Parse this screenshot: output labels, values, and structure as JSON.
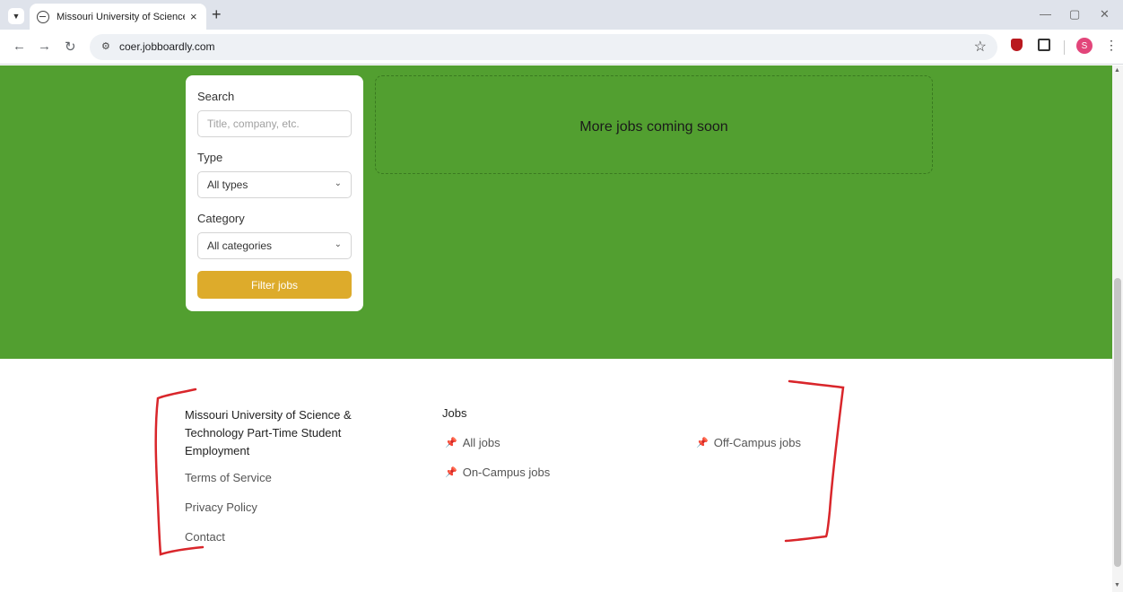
{
  "browser": {
    "tab_title": "Missouri University of Science &",
    "url": "coer.jobboardly.com",
    "profile_initial": "S",
    "tab_close": "×",
    "new_tab": "+"
  },
  "filter": {
    "search_label": "Search",
    "search_placeholder": "Title, company, etc.",
    "type_label": "Type",
    "type_value": "All types",
    "category_label": "Category",
    "category_value": "All categories",
    "button_label": "Filter jobs"
  },
  "jobs_area": {
    "message": "More jobs coming soon"
  },
  "footer": {
    "org_name": "Missouri University of Science & Technology Part-Time Student Employment",
    "links": [
      "Terms of Service",
      "Privacy Policy",
      "Contact"
    ],
    "jobs_heading": "Jobs",
    "job_links": [
      "All jobs",
      "On-Campus jobs",
      "Off-Campus jobs"
    ]
  },
  "colors": {
    "hero_background": "#529f30",
    "filter_button": "#ddab2b",
    "annotation": "#d9262b"
  },
  "icons": [
    "chevron-down-icon",
    "globe-icon",
    "close-icon",
    "plus-icon",
    "back-icon",
    "forward-icon",
    "reload-icon",
    "site-settings-icon",
    "star-icon",
    "shield-extension-icon",
    "puzzle-icon",
    "kebab-icon",
    "pushpin-icon"
  ]
}
